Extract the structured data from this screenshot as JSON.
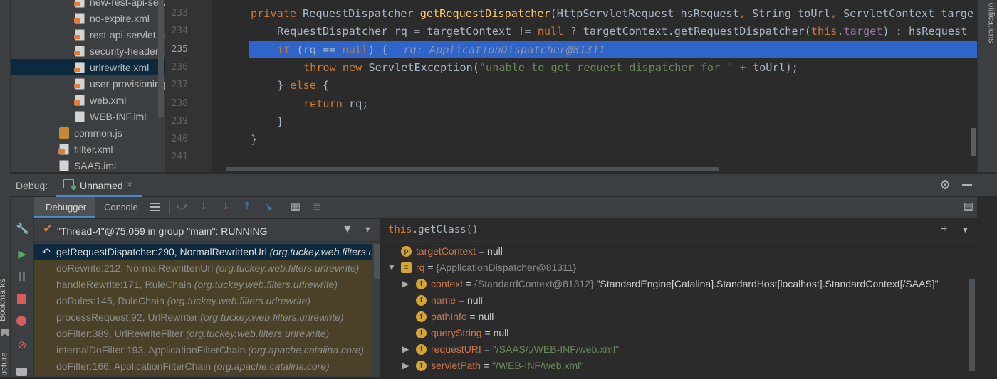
{
  "project_tree": {
    "items": [
      {
        "label": "new-rest-api-serv",
        "icon": "xml-file-icon"
      },
      {
        "label": "no-expire.xml",
        "icon": "xml-file-icon"
      },
      {
        "label": "rest-api-servlet.xı",
        "icon": "xml-file-icon"
      },
      {
        "label": "security-headers.",
        "icon": "xml-file-icon"
      },
      {
        "label": "urlrewrite.xml",
        "icon": "xml-file-icon"
      },
      {
        "label": "user-provisioning",
        "icon": "xml-file-icon"
      },
      {
        "label": "web.xml",
        "icon": "xml-file-icon"
      },
      {
        "label": "WEB-INF.iml",
        "icon": "iml-file-icon"
      },
      {
        "label": "common.js",
        "icon": "js-file-icon"
      },
      {
        "label": "fillter.xml",
        "icon": "xml-file-icon"
      },
      {
        "label": "SAAS.iml",
        "icon": "iml-file-icon"
      }
    ]
  },
  "side_strips": {
    "notifications": "otifications",
    "bookmarks": "Bookmarks",
    "structure": "ucture"
  },
  "editor": {
    "line_numbers": [
      "233",
      "234",
      "235",
      "236",
      "237",
      "238",
      "239",
      "240",
      "241"
    ],
    "current_line": "235",
    "lines": {
      "l233": {
        "kw_private": "private ",
        "type": "RequestDispatcher ",
        "method": "getRequestDispatcher",
        "params_a": "(HttpServletRequest hsRequest",
        "comma1": ", ",
        "params_b": "String toUrl",
        "comma2": ", ",
        "params_c": "ServletContext targe"
      },
      "l234": {
        "a": "RequestDispatcher rq = targetContext != ",
        "null": "null",
        "b": " ? targetContext.getRequestDispatcher(",
        "this": "this",
        "dot": ".",
        "field": "target",
        "c": ") : hsRequest"
      },
      "l235": {
        "if": "if ",
        "a": "(rq == ",
        "null": "null",
        "b": ") {",
        "inline": "rq: ApplicationDispatcher@81311"
      },
      "l236": {
        "throw": "throw ",
        "new": "new ",
        "a": "ServletException(",
        "str": "\"unable to get request dispatcher for \"",
        "b": " + toUrl);"
      },
      "l237": {
        "a": "} ",
        "else": "else",
        "b": " {"
      },
      "l238": {
        "return": "return ",
        "a": "rq;"
      },
      "l239": {
        "a": "}"
      },
      "l240": {
        "a": "}"
      }
    }
  },
  "debug": {
    "label": "Debug:",
    "session_tab": "Unnamed",
    "tabs": [
      "Debugger",
      "Console"
    ],
    "thread": "\"Thread-4\"@75,059 in group \"main\": RUNNING",
    "frames": [
      {
        "method": "getRequestDispatcher:290, NormalRewrittenUrl ",
        "pkg": "(org.tuckey.web.filters.urlrewrite)"
      },
      {
        "method": "doRewrite:212, NormalRewrittenUrl ",
        "pkg": "(org.tuckey.web.filters.urlrewrite)"
      },
      {
        "method": "handleRewrite:171, RuleChain ",
        "pkg": "(org.tuckey.web.filters.urlrewrite)"
      },
      {
        "method": "doRules:145, RuleChain ",
        "pkg": "(org.tuckey.web.filters.urlrewrite)"
      },
      {
        "method": "processRequest:92, UrlRewriter ",
        "pkg": "(org.tuckey.web.filters.urlrewrite)"
      },
      {
        "method": "doFilter:389, UrlRewriteFilter ",
        "pkg": "(org.tuckey.web.filters.urlrewrite)"
      },
      {
        "method": "internalDoFilter:193, ApplicationFilterChain ",
        "pkg": "(org.apache.catalina.core)"
      },
      {
        "method": "doFilter:166, ApplicationFilterChain ",
        "pkg": "(org.apache.catalina.core)"
      }
    ],
    "expression": {
      "this": "this",
      "rest": ".getClass()"
    },
    "variables": [
      {
        "badge": "p",
        "name": "targetContext",
        "eq": " = ",
        "value": "null",
        "kind": "null"
      },
      {
        "badge": "≡",
        "name": "rq",
        "eq": " = ",
        "value": "{ApplicationDispatcher@81311}",
        "kind": "ref"
      },
      {
        "badge": "f",
        "name": "context",
        "eq": " = ",
        "value": "{StandardContext@81312} ",
        "extra": "\"StandardEngine[Catalina].StandardHost[localhost].StandardContext[/SAAS]\"",
        "kind": "ref"
      },
      {
        "badge": "f",
        "name": "name",
        "eq": " = ",
        "value": "null",
        "kind": "null"
      },
      {
        "badge": "f",
        "name": "pathInfo",
        "eq": " = ",
        "value": "null",
        "kind": "null"
      },
      {
        "badge": "f",
        "name": "queryString",
        "eq": " = ",
        "value": "null",
        "kind": "null"
      },
      {
        "badge": "f",
        "name": "requestURI",
        "eq": " = ",
        "value": "\"/SAAS/;/WEB-INF/web.xml\"",
        "kind": "str"
      },
      {
        "badge": "f",
        "name": "servletPath",
        "eq": " = ",
        "value": "\"/WEB-INF/web.xml\"",
        "kind": "str"
      }
    ]
  },
  "colors": {
    "selection": "#2f65ca",
    "frame_bg": "#4a4128",
    "keyword": "#cc7832",
    "method": "#ffc66d",
    "string": "#6a8759"
  }
}
